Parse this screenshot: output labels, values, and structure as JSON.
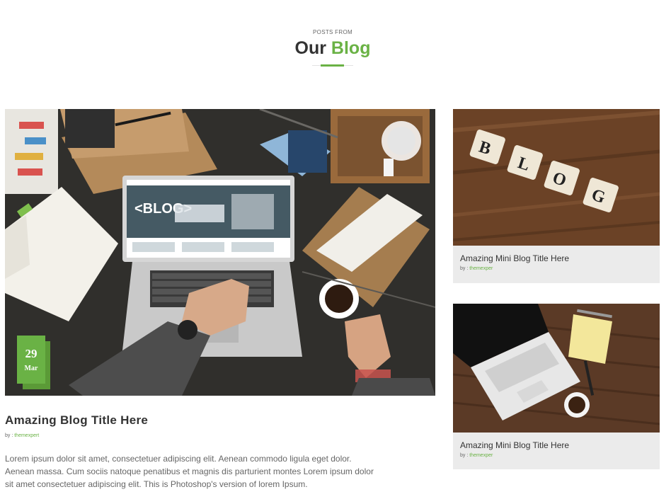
{
  "section": {
    "eyebrow": "POSTS FROM",
    "title_plain": "Our",
    "title_accent": "Blog"
  },
  "featured": {
    "date_day": "29",
    "date_month": "Mar",
    "title": "Amazing Blog Title Here",
    "by_prefix": "by : ",
    "author": "themexpert",
    "excerpt": "Lorem ipsum dolor sit amet, consectetuer adipiscing elit. Aenean commodo ligula eget dolor. Aenean massa. Cum sociis natoque penatibus et magnis dis parturient montes Lorem ipsum dolor sit amet consectetuer adipiscing elit. This is Photoshop's version of lorem Ipsum.",
    "screen_text": "<BLOG>",
    "tiles": [
      "B",
      "L",
      "O",
      "G"
    ]
  },
  "mini_posts": [
    {
      "title": "Amazing Mini Blog Title Here",
      "by_prefix": "by : ",
      "author": "themexper"
    },
    {
      "title": "Amazing Mini Blog Title Here",
      "by_prefix": "by : ",
      "author": "themexper"
    }
  ],
  "colors": {
    "accent": "#6ab245",
    "card_bg": "#ebebeb",
    "text": "#333333",
    "muted": "#666666"
  }
}
